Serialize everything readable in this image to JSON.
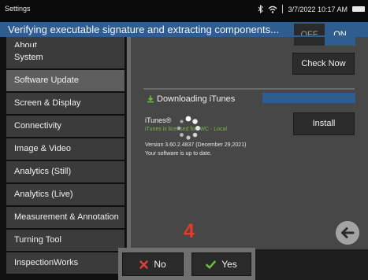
{
  "status_bar": {
    "title": "Settings",
    "datetime": "3/7/2022 10:17 AM",
    "icons": [
      "bluetooth-icon",
      "wifi-icon",
      "battery-icon"
    ]
  },
  "banner": {
    "message": "Verifying executable signature and extracting components..."
  },
  "sidebar": {
    "items": [
      {
        "label": "About"
      },
      {
        "label": "System"
      },
      {
        "label": "Software Update",
        "active": true
      },
      {
        "label": "Screen & Display"
      },
      {
        "label": "Connectivity"
      },
      {
        "label": "Image & Video"
      },
      {
        "label": "Analytics (Still)"
      },
      {
        "label": "Analytics (Live)"
      },
      {
        "label": "Measurement & Annotation"
      },
      {
        "label": "Turning Tool"
      },
      {
        "label": "InspectionWorks"
      }
    ]
  },
  "content": {
    "toggle": {
      "off_label": "OFF",
      "on_label": "ON",
      "state": "ON"
    },
    "check_now_label": "Check Now",
    "download": {
      "label": "Downloading iTunes",
      "progress": 1.0
    },
    "itunes": {
      "title": "iTunes®",
      "licensed": "iTunes is licensed for IWC - Local",
      "version": "Version 3.60.2.4837 (December 29,2021)",
      "status": "Your software is up to date."
    },
    "install_label": "Install"
  },
  "actions": {
    "no_label": "No",
    "yes_label": "Yes"
  },
  "annotation": {
    "step_number": "4"
  },
  "colors": {
    "accent": "#2f5d8f",
    "no_icon": "#e0403a",
    "yes_icon": "#6abf3a",
    "licensed_text": "#78b84a",
    "annotation": "#e6392b"
  }
}
